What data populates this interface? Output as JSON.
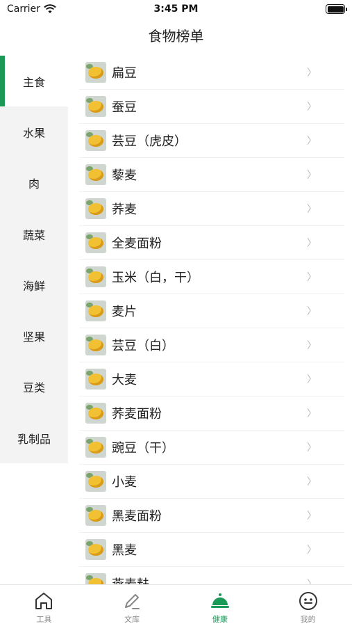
{
  "status_bar": {
    "carrier": "Carrier",
    "time": "3:45 PM"
  },
  "nav": {
    "title": "食物榜单"
  },
  "sidebar": {
    "items": [
      {
        "label": "主食",
        "active": true
      },
      {
        "label": "水果"
      },
      {
        "label": "肉"
      },
      {
        "label": "蔬菜"
      },
      {
        "label": "海鲜"
      },
      {
        "label": "坚果"
      },
      {
        "label": "豆类"
      },
      {
        "label": "乳制品"
      }
    ]
  },
  "list": {
    "items": [
      {
        "name": "扁豆"
      },
      {
        "name": "蚕豆"
      },
      {
        "name": "芸豆（虎皮）"
      },
      {
        "name": "藜麦"
      },
      {
        "name": "荞麦"
      },
      {
        "name": "全麦面粉"
      },
      {
        "name": "玉米（白，干）"
      },
      {
        "name": "麦片"
      },
      {
        "name": "芸豆（白）"
      },
      {
        "name": "大麦"
      },
      {
        "name": "荞麦面粉"
      },
      {
        "name": "豌豆（干）"
      },
      {
        "name": "小麦"
      },
      {
        "name": "黑麦面粉"
      },
      {
        "name": "黑麦"
      },
      {
        "name": "燕麦麸"
      }
    ],
    "chevron": "〉"
  },
  "tabbar": {
    "tabs": [
      {
        "label": "工具",
        "icon": "home-icon"
      },
      {
        "label": "文库",
        "icon": "pencil-icon"
      },
      {
        "label": "健康",
        "icon": "cloche-icon",
        "active": true
      },
      {
        "label": "我的",
        "icon": "face-icon"
      }
    ]
  },
  "colors": {
    "accent": "#1a9a56",
    "sidebar_bg": "#f3f3f3"
  }
}
